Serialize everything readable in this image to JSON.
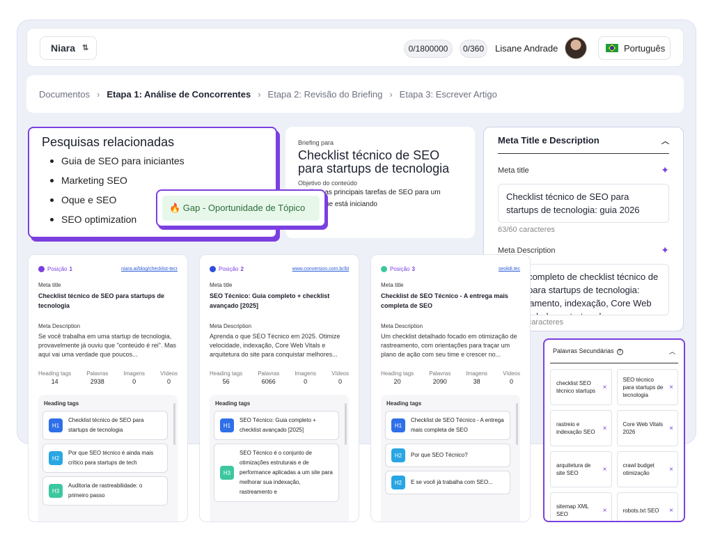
{
  "topbar": {
    "workspace": "Niara",
    "credits_1": "0/1800000",
    "credits_2": "0/360",
    "user_name": "Lisane Andrade",
    "language": "Português"
  },
  "breadcrumb": {
    "root": "Documentos",
    "step1": "Etapa 1:  Análise de Concorrentes",
    "step2": "Etapa 2:  Revisão do Briefing",
    "step3": "Etapa 3:  Escrever Artigo"
  },
  "related": {
    "title": "Pesquisas relacionadas",
    "items": [
      "Guia de SEO para iniciantes",
      "Marketing SEO",
      "Oque e SEO",
      "SEO optimization"
    ],
    "gap_badge": "🔥 Gap - Oportunidade de Tópico"
  },
  "briefing": {
    "label": "Briefing para",
    "title": "Checklist técnico de SEO para startups de tecnologia",
    "objective_label": "Objetivo do conteúdo",
    "objective_text": "Explicar as principais tarefas de SEO para um startup que está iniciando"
  },
  "meta": {
    "panel_title": "Meta Title e Description",
    "title_label": "Meta title",
    "title_value": "Checklist técnico de SEO para startups de tecnologia: guia 2026",
    "title_count": "63/60 caracteres",
    "desc_label": "Meta Description",
    "desc_value": "Guia completo de checklist técnico de SEO para startups de tecnologia: rastreamento, indexação, Core Web Vitals, dados estruturados e...",
    "desc_count": "149/160 caracteres"
  },
  "labels": {
    "position": "Posição",
    "meta_title": "Meta title",
    "meta_description": "Meta Description",
    "heading_tags": "Heading tags",
    "words": "Palavras",
    "images": "Imagens",
    "videos": "Vídeos"
  },
  "cards": [
    {
      "position": "1",
      "url": "niara.ai/blog/checklist-tecr",
      "meta_title": "Checklist técnico de SEO para startups de tecnologia",
      "meta_desc": "Se você trabalha em uma startup de tecnologia, provavelmente já ouviu que \"conteúdo é rei\". Mas aqui vai uma verdade que poucos...",
      "stats": {
        "headings": "14",
        "words": "2938",
        "images": "0",
        "videos": "0"
      },
      "headings": [
        {
          "tag": "H1",
          "text": "Checklist técnico de SEO para startups de tecnologia"
        },
        {
          "tag": "H2",
          "text": "Por que SEO técnico é ainda mais crítico para startups de tech"
        },
        {
          "tag": "H3",
          "text": "Auditoria de rastreabilidade: o primeiro passo"
        }
      ]
    },
    {
      "position": "2",
      "url": "www.conversion.com.br/bl",
      "meta_title": "SEO Técnico: Guia completo + checklist avançado [2025]",
      "meta_desc": "Aprenda o que SEO Técnico em 2025. Otimize velocidade, indexação, Core Web Vitals e arquitetura do site para conquistar melhores...",
      "stats": {
        "headings": "56",
        "words": "6066",
        "images": "0",
        "videos": "0"
      },
      "headings": [
        {
          "tag": "H1",
          "text": "SEO Técnico: Guia completo + checklist avançado [2025]"
        },
        {
          "tag": "H3",
          "text": "SEO Técnico é o conjunto de otimizações estruturais e de performance aplicadas a um site para melhorar sua indexação, rastreamento e"
        }
      ]
    },
    {
      "position": "3",
      "url": "seolidi.tec",
      "meta_title": "Checklist de SEO Técnico - A entrega mais completa de SEO",
      "meta_desc": "Um checklist detalhado focado em otimização de rastreamento, com orientações para traçar um plano de ação com seu time e crescer no...",
      "stats": {
        "headings": "20",
        "words": "2090",
        "images": "38",
        "videos": "0"
      },
      "headings": [
        {
          "tag": "H1",
          "text": "Checklist de SEO Técnico - A entrega mais completa de SEO"
        },
        {
          "tag": "H2",
          "text": "Por que SEO Técnico?"
        },
        {
          "tag": "H2",
          "text": "E se você já trabalha com SEO..."
        }
      ]
    }
  ],
  "keywords": {
    "title": "Palavras Secundárias",
    "items": [
      "checklist SEO técnico startups",
      "SEO técnico para startups de tecnologia",
      "rastreio e indexação SEO",
      "Core Web Vitals 2026",
      "arquitetura de site SEO",
      "crawl budget otimização",
      "sitemap XML SEO",
      "robots.txt SEO"
    ],
    "remove_icon": "×"
  },
  "colors": {
    "accent": "#7b3fe0",
    "link": "#2a5bd7",
    "h1": "#2f6fe8",
    "h2": "#29a6e3",
    "h3": "#3cc7a0"
  }
}
